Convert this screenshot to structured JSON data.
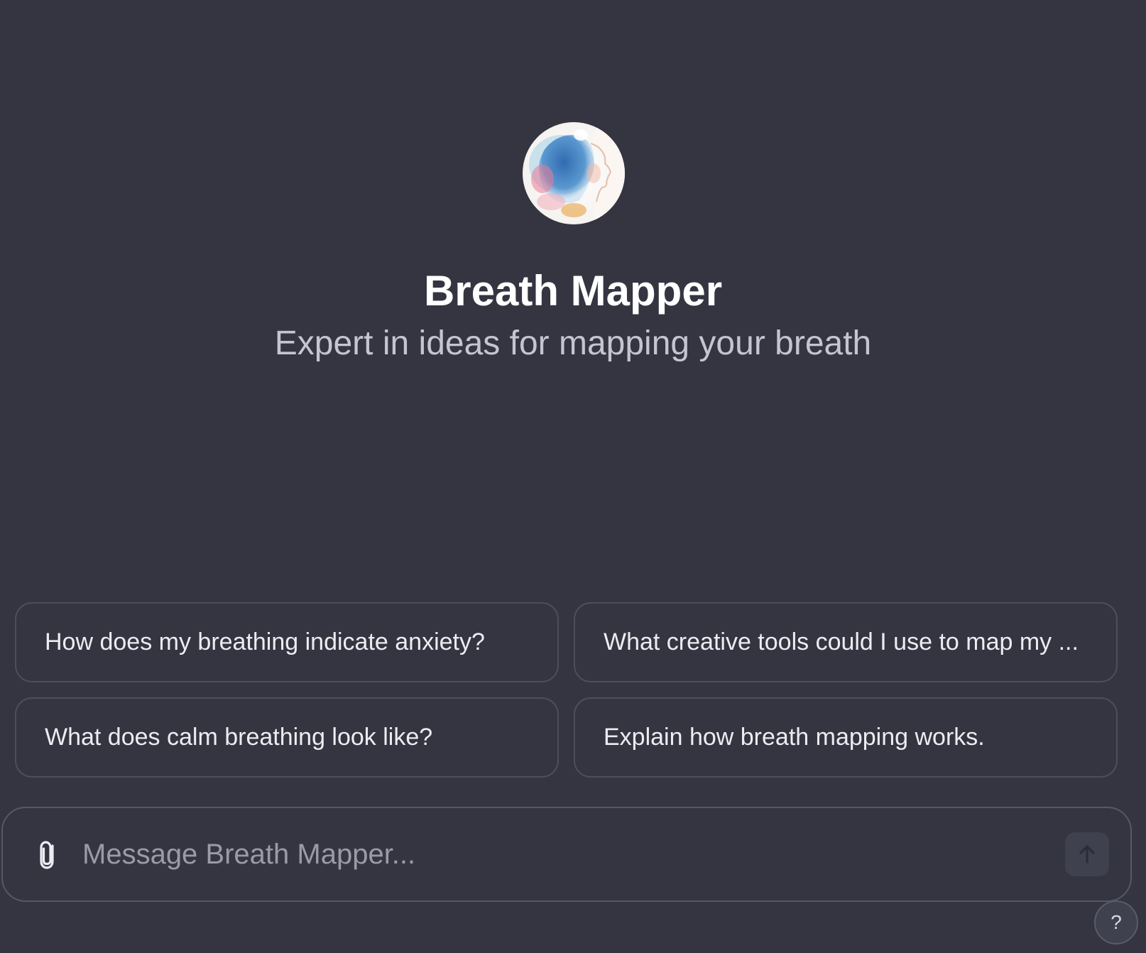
{
  "gpt": {
    "name": "Breath Mapper",
    "description": "Expert in ideas for mapping your breath",
    "avatar_icon": "watercolor-profile-avatar"
  },
  "suggestions": [
    {
      "label": "How does my breathing indicate anxiety?"
    },
    {
      "label": "What creative tools could I use to map my ..."
    },
    {
      "label": "What does calm breathing look like?"
    },
    {
      "label": "Explain how breath mapping works."
    }
  ],
  "composer": {
    "placeholder": "Message Breath Mapper...",
    "attach_icon": "paperclip-icon",
    "send_icon": "arrow-up-icon"
  },
  "help": {
    "label": "?"
  },
  "colors": {
    "background": "#343541",
    "border": "#4d4d5c",
    "title": "#ffffff",
    "subtitle": "#c5c5d2"
  }
}
